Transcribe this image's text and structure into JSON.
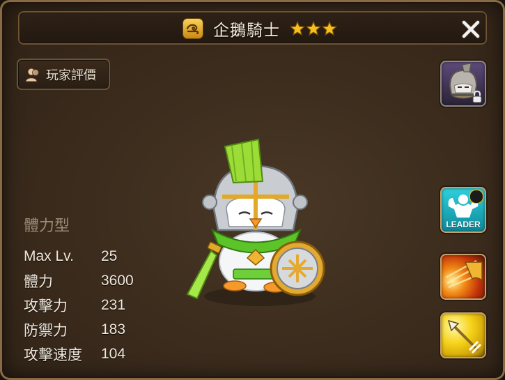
{
  "header": {
    "title": "企鵝騎士",
    "stars": 3,
    "element_icon": "wind-element-icon",
    "close_icon": "close-icon"
  },
  "rating_button": {
    "label": "玩家評價",
    "icon": "person-icon"
  },
  "stats": {
    "type": "體力型",
    "rows": [
      {
        "label": "Max Lv.",
        "value": "25"
      },
      {
        "label": "體力",
        "value": "3600"
      },
      {
        "label": "攻擊力",
        "value": "231"
      },
      {
        "label": "防禦力",
        "value": "183"
      },
      {
        "label": "攻擊速度",
        "value": "104"
      }
    ]
  },
  "side_buttons": {
    "awakened_portrait": {
      "icon": "awakened-penguin-knight-portrait",
      "locked": true
    },
    "leader_skill": {
      "label": "LEADER",
      "icon": "leader-muscle-icon"
    },
    "skill_1": {
      "icon": "fire-slash-skill-icon"
    },
    "skill_2": {
      "icon": "spear-thrust-skill-icon"
    }
  },
  "colors": {
    "panel_bg": "#3d2d1e",
    "panel_border": "#8a6a45",
    "gold_star": "#f5c21c",
    "text_light": "#f0e8da",
    "text_muted": "#9b8b76",
    "leader_teal": "#1fb6c2"
  }
}
